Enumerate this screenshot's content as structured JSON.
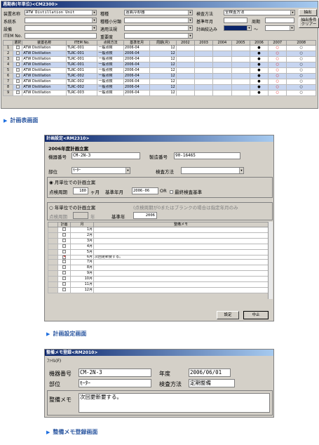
{
  "win1": {
    "title": "週期表(年単位)<CM2300>",
    "labels": {
      "device_name": "装置名称",
      "type": "種種",
      "check_method": "検査方法",
      "system": "系統系",
      "sub_type": "種種小分類",
      "base_year": "基準年月",
      "period": "周期",
      "equipment": "設備",
      "law": "適用法規",
      "plan_filter": "計画絞込み",
      "item_no": "ITEM No.",
      "importance": "重要度",
      "tilde": "～"
    },
    "values": {
      "device_name": "ATW Distillation Unit",
      "type": "遠面冷却器",
      "check_method": "全検査方法"
    },
    "buttons": {
      "extract": "抽出",
      "clear": "抽出条件クリアー"
    },
    "table_headers": [
      "選択",
      "装置名称",
      "ITEM No.",
      "点検方法",
      "基準年月",
      "周期(月)",
      "2002",
      "2003",
      "2004",
      "2005",
      "2006",
      "2007",
      "2008"
    ],
    "rows": [
      {
        "no": "1",
        "name": "ATW Distillation",
        "item": "TLRC-001",
        "method": "一般点検",
        "base": "2006-04",
        "cycle": "12",
        "mark06": "●",
        "mark07": "○",
        "mark08": "○"
      },
      {
        "no": "2",
        "name": "ATW Distillation",
        "item": "TLRC-001",
        "method": "一般点検",
        "base": "2006-04",
        "cycle": "12",
        "mark06": "●",
        "mark07": "○",
        "mark08": "○"
      },
      {
        "no": "3",
        "name": "ATW Distillation",
        "item": "TLRC-001",
        "method": "一般点検",
        "base": "2006-04",
        "cycle": "12",
        "mark06": "●",
        "mark07": "○",
        "mark08": "○"
      },
      {
        "no": "4",
        "name": "ATW Distillation",
        "item": "TLRC-001",
        "method": "一般点検",
        "base": "2006-04",
        "cycle": "12",
        "mark06": "●",
        "mark07": "○",
        "mark08": "○"
      },
      {
        "no": "5",
        "name": "ATW Distillation",
        "item": "TLRC-001",
        "method": "一般点検",
        "base": "2006-04",
        "cycle": "12",
        "mark06": "●",
        "mark07": "○",
        "mark08": "○"
      },
      {
        "no": "6",
        "name": "ATW Distillation",
        "item": "TLRC-002",
        "method": "一般点検",
        "base": "2006-04",
        "cycle": "12",
        "mark06": "●",
        "mark07": "○",
        "mark08": "○"
      },
      {
        "no": "7",
        "name": "ATW Distillation",
        "item": "TLRC-002",
        "method": "一般点検",
        "base": "2006-04",
        "cycle": "12",
        "mark06": "●",
        "mark07": "○",
        "mark08": "○"
      },
      {
        "no": "8",
        "name": "ATW Distillation",
        "item": "TLRC-002",
        "method": "一般点検",
        "base": "2006-04",
        "cycle": "12",
        "mark06": "●",
        "mark07": "○",
        "mark08": "○"
      },
      {
        "no": "9",
        "name": "ATW Distillation",
        "item": "TLRC-003",
        "method": "一般点検",
        "base": "2006-04",
        "cycle": "12",
        "mark06": "●",
        "mark07": "○",
        "mark08": "○"
      }
    ]
  },
  "caption1": "計画表画面",
  "win2": {
    "title": "計画設定<RM2310>",
    "heading": "2006年度計画立案",
    "labels": {
      "machine_no": "機器番号",
      "mfg_no": "製造番号",
      "part": "部位",
      "check_method": "検査方法",
      "monthly": "月単位での計画立案",
      "cycle": "点検周期",
      "months": "ヶ月",
      "base_month": "基準年月",
      "or": "OR",
      "last_base": "最終検査基準",
      "yearly": "年単位での計画立案",
      "yearly_note": "(点検周期が0またはブランクの場合は指定年月のみ",
      "cycle2": "点検周期",
      "year_unit": "年",
      "base_year": "基準年",
      "plan": "計画",
      "month": "月",
      "memo": "整備メモ"
    },
    "values": {
      "machine_no": "CM-2N-3",
      "mfg_no": "90-16465",
      "part": "ﾓｰﾀｰ",
      "cycle": "180",
      "base_month": "2006-06",
      "base_year": "2006"
    },
    "months": [
      "1月",
      "2月",
      "3月",
      "4月",
      "5月",
      "6月",
      "7月",
      "8月",
      "9月",
      "10月",
      "11月",
      "12月"
    ],
    "memo_row": "次回更新要する。",
    "buttons": {
      "set": "設定",
      "cancel": "中止"
    }
  },
  "caption2": "計画設定画面",
  "win3": {
    "title": "整備メモ登録<RM2010>",
    "menu": "ﾌｧｲﾙ(F)",
    "labels": {
      "machine_no": "機器番号",
      "year": "年度",
      "part": "部位",
      "check_method": "検査方法",
      "memo": "整備メモ"
    },
    "values": {
      "machine_no": "CM-2N-3",
      "year": "2006/06/01",
      "part": "ﾓｰﾀｰ",
      "check_method": "定期整備",
      "memo": "次回更新要する。"
    }
  },
  "caption3": "整備メモ登録画面",
  "colors": {
    "titlebar": "#0a246a",
    "highlight_row": "#c7d5f0",
    "caption": "#2a56a0",
    "check_red": "#c00000"
  }
}
